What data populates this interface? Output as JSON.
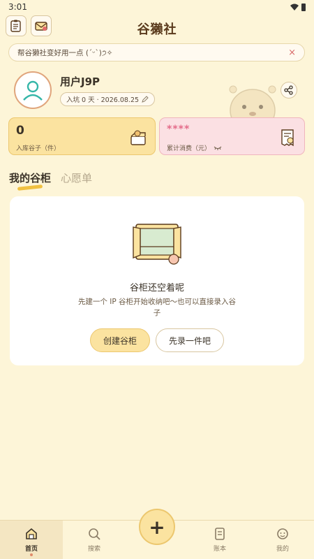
{
  "status_bar": {
    "time": "3:01"
  },
  "app": {
    "title": "谷獭社"
  },
  "notice": {
    "text": "帮谷獭社变好用一点 (ˊᵕˋ)੭✧",
    "close": "×"
  },
  "profile": {
    "username": "用户J9P",
    "joined_text": "入坑 0 天 · 2026.08.25"
  },
  "stats": {
    "items": {
      "value": "0",
      "label": "入库谷子（件）"
    },
    "spending": {
      "value": "****",
      "label": "累计消费（元）"
    }
  },
  "tabs": [
    {
      "label": "我的谷柜",
      "active": true
    },
    {
      "label": "心愿单",
      "active": false
    }
  ],
  "empty_state": {
    "title": "谷柜还空着呢",
    "description": "先建一个 IP 谷柜开始收纳吧～也可以直接录入谷子",
    "primary_button": "创建谷柜",
    "secondary_button": "先录一件吧"
  },
  "bottom_nav": {
    "items": [
      {
        "label": "首页",
        "icon": "home-icon",
        "active": true
      },
      {
        "label": "搜索",
        "icon": "search-icon",
        "active": false
      },
      {
        "label": "账本",
        "icon": "ledger-icon",
        "active": false
      },
      {
        "label": "我的",
        "icon": "profile-icon",
        "active": false
      }
    ],
    "fab": "+"
  },
  "colors": {
    "background": "#fdf5d8",
    "accent_yellow": "#fbe3a0",
    "accent_pink": "#fbe0e3"
  }
}
